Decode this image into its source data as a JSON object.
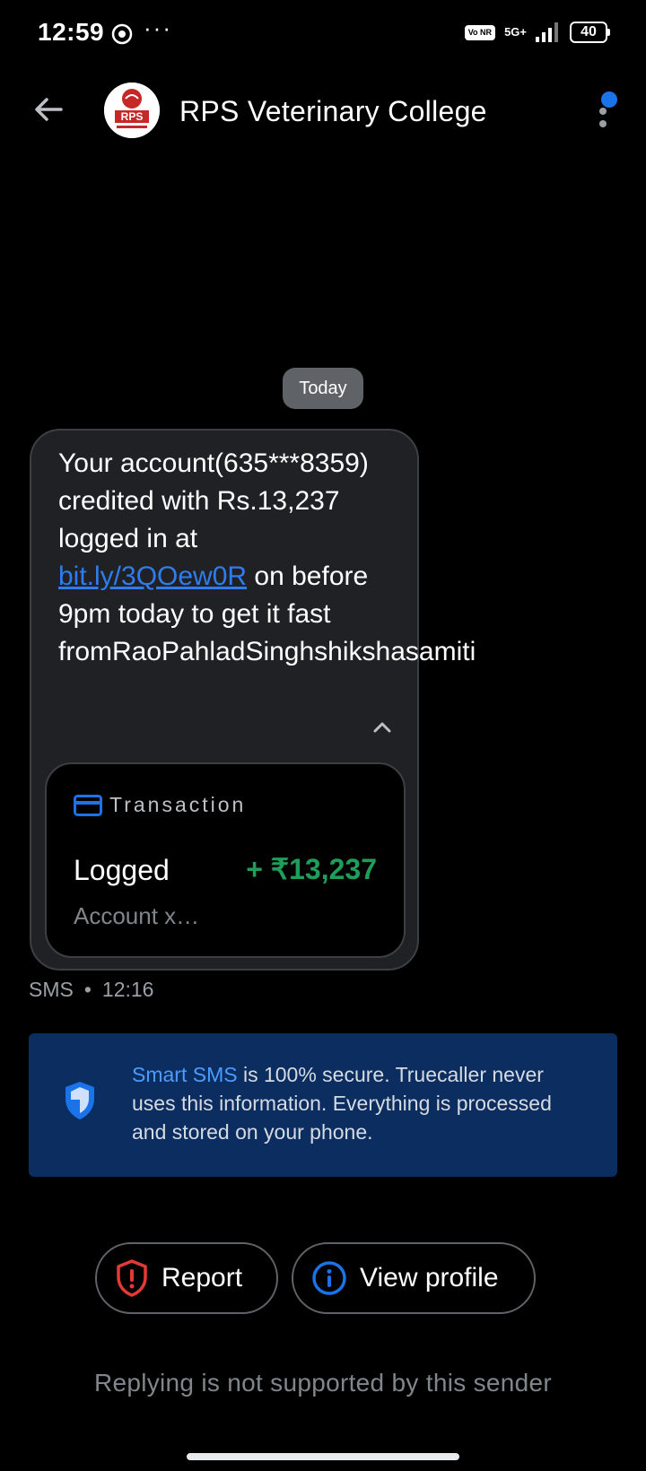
{
  "status_bar": {
    "time": "12:59",
    "more_indicator": "···",
    "volte": "Vo NR",
    "network": "5G+",
    "battery": "40"
  },
  "header": {
    "title": "RPS Veterinary College",
    "avatar_text": "RPS"
  },
  "conversation": {
    "date_chip": "Today",
    "message": {
      "text_before_link": "Your account(635***8359) credited with Rs.13,237 logged in at ",
      "link": "bit.ly/3QOew0R",
      "text_after_link": " on before 9pm today to get it fast fromRaoPahladSinghshikshasamiti"
    },
    "transaction": {
      "label": "Transaction",
      "status": "Logged",
      "amount": "+ ₹13,237",
      "account": "Account x…",
      "amount_color": "#1e9e5a"
    },
    "meta": {
      "channel": "SMS",
      "separator": "•",
      "time": "12:16"
    }
  },
  "info_banner": {
    "highlight": "Smart SMS",
    "text": " is 100% secure. Truecaller never uses this information. Everything is processed and stored on your phone."
  },
  "actions": {
    "report_label": "Report",
    "view_profile_label": "View profile"
  },
  "footer_note": "Replying is not supported by this sender",
  "colors": {
    "background": "#000000",
    "accent_blue": "#1a73e8",
    "report_red": "#e53935",
    "banner_bg": "#0c2d5f"
  }
}
